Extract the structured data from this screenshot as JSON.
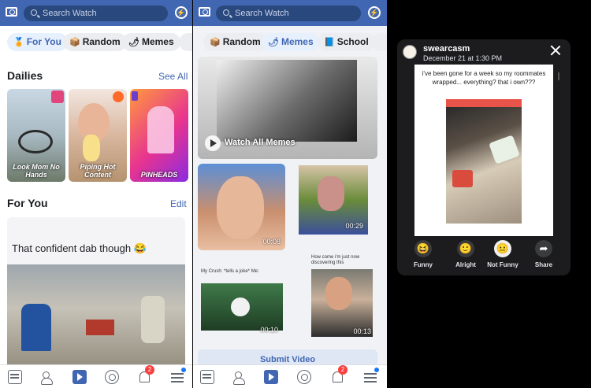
{
  "left_screen": {
    "search_placeholder": "Search Watch",
    "chips": [
      {
        "label": "For You",
        "icon": "🏅"
      },
      {
        "label": "Random",
        "icon": "📦"
      },
      {
        "label": "Memes",
        "icon": "🌶"
      }
    ],
    "dailies": {
      "title": "Dailies",
      "see_all": "See All",
      "items": [
        {
          "caption": "Look Mom No Hands"
        },
        {
          "caption": "Piping Hot Content"
        },
        {
          "caption": "PINHEADS"
        }
      ]
    },
    "for_you": {
      "title": "For You",
      "edit": "Edit",
      "post_caption": "That confident dab though 😂"
    },
    "tabbar": {
      "notifications_badge": "2"
    }
  },
  "middle_screen": {
    "search_placeholder": "Search Watch",
    "chips": [
      {
        "label": "Random",
        "icon": "📦"
      },
      {
        "label": "Memes",
        "icon": "🌶"
      },
      {
        "label": "School",
        "icon": "📘"
      }
    ],
    "hero_label": "Watch All Memes",
    "videos": [
      {
        "duration": "00:08"
      },
      {
        "duration": "00:29"
      },
      {
        "duration": "00:10",
        "caption": "My Crush: *tells a joke* Me:"
      },
      {
        "duration": "00:13",
        "caption": "How come i'm just now discovering this"
      }
    ],
    "submit_label": "Submit Video",
    "tabbar": {
      "notifications_badge": "2"
    }
  },
  "story": {
    "username": "swearcasm",
    "date": "December 21 at 1:30 PM",
    "post_text": "i've been gone for a week so my roommates wrapped... everything? that i own???",
    "reactions": [
      {
        "label": "Funny",
        "icon": "😆"
      },
      {
        "label": "Alright",
        "icon": "🙂"
      },
      {
        "label": "Not Funny",
        "icon": "😐"
      },
      {
        "label": "Share",
        "icon": "➦"
      }
    ]
  }
}
